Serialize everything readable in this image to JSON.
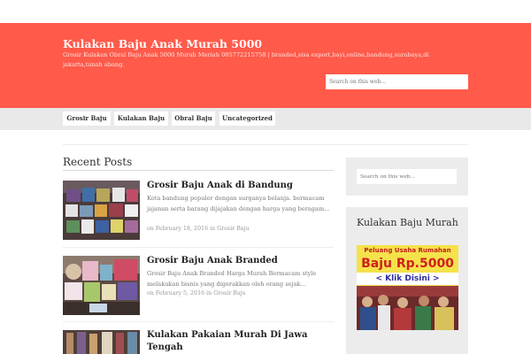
{
  "header": {
    "title": "Kulakan Baju Anak Murah 5000",
    "description": "Grosir Kulakan Obral Baju Anak 5000 Murah Meriah 085772215758 | branded,sisa export,bayi,online,bandung,surabaya,di jakarta,tanah abang.",
    "search_placeholder": "Search on this web..."
  },
  "nav": {
    "items": [
      "Grosir Baju",
      "Kulakan Baju",
      "Obral Baju",
      "Uncategorized"
    ]
  },
  "main": {
    "heading": "Recent Posts",
    "posts": [
      {
        "title": "Grosir Baju Anak di Bandung",
        "excerpt": "Kota bandung populer dengan surganya belanja. bermacam jajanan serta barang dijajakan dengan harga yang beragam...",
        "date": "February 18, 2016",
        "on": "on",
        "in": "in",
        "category": "Grosir Baju"
      },
      {
        "title": "Grosir Baju Anak Branded",
        "excerpt": "Grosir Baju Anak Branded Harga Murah Bermacam style melakukan bisnis yang digerakkan oleh orang sejak...",
        "date": "February 5, 2016",
        "on": "on",
        "in": "in",
        "category": "Grosir Baju"
      },
      {
        "title": "Kulakan Pakaian Murah Di Jawa Tengah"
      }
    ]
  },
  "sidebar": {
    "search_placeholder": "Search on this web...",
    "widget_title": "Kulakan Baju Murah",
    "banner": {
      "top_text": "Peluang Usaha Rumahan",
      "price_text": "Baju Rp.5000",
      "click_text": "< Klik Disini >"
    }
  },
  "colors": {
    "header_bg": "#ff5a4a",
    "nav_bg": "#e9e9e9",
    "sidebar_bg": "#ececec"
  }
}
